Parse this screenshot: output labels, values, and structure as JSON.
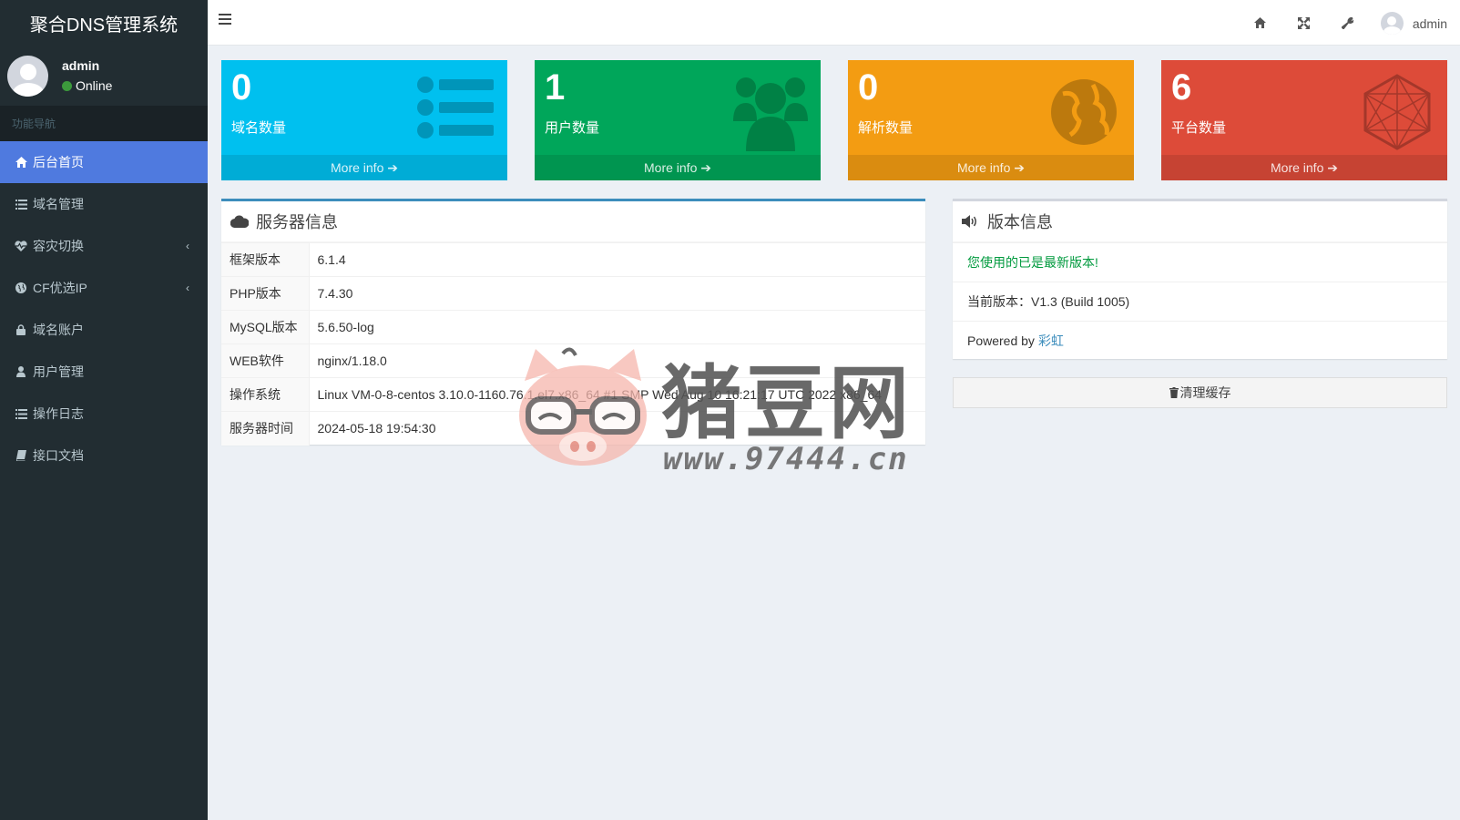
{
  "app": {
    "title": "聚合DNS管理系统"
  },
  "user": {
    "name": "admin",
    "status": "Online"
  },
  "nav": {
    "header": "功能导航",
    "items": [
      {
        "label": "后台首页",
        "icon": "home-icon",
        "active": true
      },
      {
        "label": "域名管理",
        "icon": "list-icon"
      },
      {
        "label": "容灾切换",
        "icon": "heartbeat-icon",
        "has_submenu": true
      },
      {
        "label": "CF优选IP",
        "icon": "globe-icon",
        "has_submenu": true
      },
      {
        "label": "域名账户",
        "icon": "lock-icon"
      },
      {
        "label": "用户管理",
        "icon": "user-icon"
      },
      {
        "label": "操作日志",
        "icon": "list-icon"
      },
      {
        "label": "接口文档",
        "icon": "book-icon"
      }
    ]
  },
  "header": {
    "icons": [
      "home-icon",
      "fullscreen-icon",
      "wrench-icon"
    ],
    "user_name": "admin"
  },
  "stats": [
    {
      "value": "0",
      "label": "域名数量",
      "more": "More info",
      "color": "#00c0ef",
      "icon": "list-icon"
    },
    {
      "value": "1",
      "label": "用户数量",
      "more": "More info",
      "color": "#00a65a",
      "icon": "users-icon"
    },
    {
      "value": "0",
      "label": "解析数量",
      "more": "More info",
      "color": "#f39c12",
      "icon": "globe-icon"
    },
    {
      "value": "6",
      "label": "平台数量",
      "more": "More info",
      "color": "#dd4b39",
      "icon": "hexagon-icon"
    }
  ],
  "server": {
    "title": "服务器信息",
    "rows": [
      {
        "key": "框架版本",
        "value": "6.1.4"
      },
      {
        "key": "PHP版本",
        "value": "7.4.30"
      },
      {
        "key": "MySQL版本",
        "value": "5.6.50-log"
      },
      {
        "key": "WEB软件",
        "value": "nginx/1.18.0"
      },
      {
        "key": "操作系统",
        "value": "Linux VM-0-8-centos 3.10.0-1160.76.1.el7.x86_64 #1 SMP Wed Aug 10 16:21:17 UTC 2022 x86_64"
      },
      {
        "key": "服务器时间",
        "value": "2024-05-18 19:54:30"
      }
    ]
  },
  "version": {
    "title": "版本信息",
    "latest_msg": "您使用的已是最新版本!",
    "current": "当前版本：V1.3 (Build 1005)",
    "powered_prefix": "Powered by",
    "powered_link": "彩虹"
  },
  "clear_cache": "清理缓存",
  "watermark": {
    "text": "猪豆网",
    "url": "www.97444.cn"
  }
}
